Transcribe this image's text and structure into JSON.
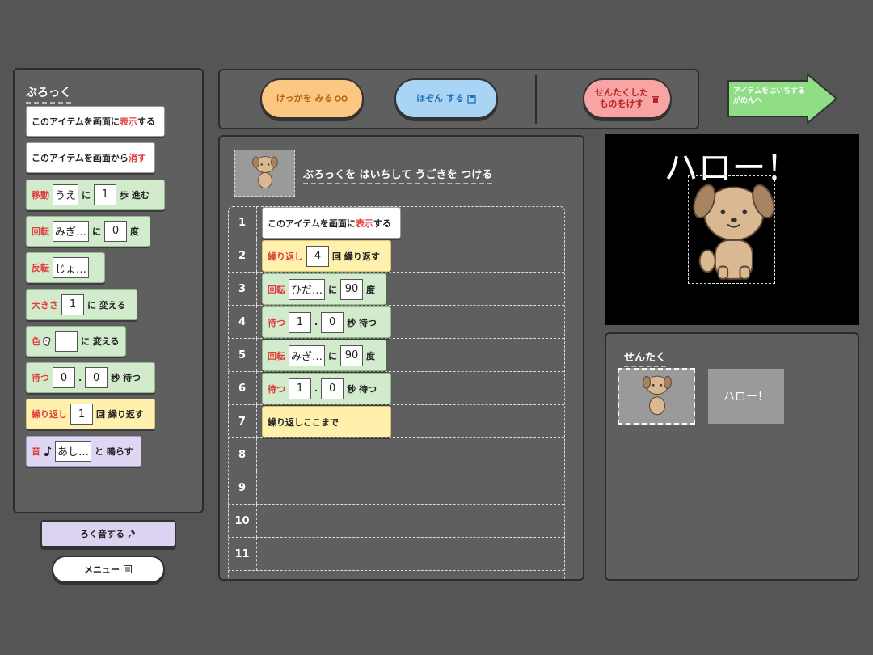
{
  "palette": {
    "heading": "ぶろっく",
    "blocks": [
      {
        "parts": [
          {
            "t": "このアイテムを画面に"
          },
          {
            "t": "表示",
            "red": true
          },
          {
            "t": "する"
          }
        ]
      },
      {
        "parts": [
          {
            "t": "このアイテムを画面から"
          },
          {
            "t": "消す",
            "red": true
          }
        ]
      },
      {
        "parts": [
          {
            "t": "移動",
            "red": true
          },
          {
            "box": "うえ"
          },
          {
            "t": "に"
          },
          {
            "box": "1"
          },
          {
            "t": "歩 進む"
          }
        ]
      },
      {
        "parts": [
          {
            "t": "回転",
            "red": true
          },
          {
            "box": "みぎ…"
          },
          {
            "t": "に"
          },
          {
            "box": "0"
          },
          {
            "t": "度"
          }
        ]
      },
      {
        "parts": [
          {
            "t": "反転",
            "red": true
          },
          {
            "box": "じょ…"
          }
        ]
      },
      {
        "parts": [
          {
            "t": "大きさ",
            "red": true
          },
          {
            "box": "1"
          },
          {
            "t": "に 変える"
          }
        ]
      },
      {
        "parts": [
          {
            "t": "色",
            "red": true
          },
          {
            "icon": "palette-icon"
          },
          {
            "box": " "
          },
          {
            "t": "に 変える"
          }
        ]
      },
      {
        "parts": [
          {
            "t": "待つ",
            "red": true
          },
          {
            "box": "0"
          },
          {
            "t": "."
          },
          {
            "box": "0"
          },
          {
            "t": "秒 待つ"
          }
        ]
      },
      {
        "parts": [
          {
            "t": "繰り返し",
            "red": true
          },
          {
            "box": "1"
          },
          {
            "t": "回 繰り返す"
          }
        ]
      },
      {
        "parts": [
          {
            "t": "音",
            "red": true
          },
          {
            "icon": "music-note-icon"
          },
          {
            "box": "あし…"
          },
          {
            "t": "と 鳴らす"
          }
        ]
      }
    ]
  },
  "buttons": {
    "record": "ろく音する",
    "menu": "メニュー"
  },
  "toolbar": {
    "result": "けっかを みる",
    "save": "ほぞん する",
    "delete_line1": "せんたくした",
    "delete_line2": "ものをけす"
  },
  "nav": {
    "line1": "アイテムをはいちする",
    "line2": "がめんへ"
  },
  "editor": {
    "heading": "ぶろっくを はいちして うごきを つける",
    "row_numbers": [
      "1",
      "2",
      "3",
      "4",
      "5",
      "6",
      "7",
      "8",
      "9",
      "10",
      "11"
    ],
    "rows": [
      {
        "parts": [
          {
            "t": "このアイテムを画面に"
          },
          {
            "t": "表示",
            "red": true
          },
          {
            "t": "する"
          }
        ]
      },
      {
        "parts": [
          {
            "t": "繰り返し",
            "red": true
          },
          {
            "box": "4"
          },
          {
            "t": "回 繰り返す"
          }
        ]
      },
      {
        "parts": [
          {
            "t": "回転",
            "red": true
          },
          {
            "box": "ひだ…"
          },
          {
            "t": "に"
          },
          {
            "box": "90"
          },
          {
            "t": "度"
          }
        ]
      },
      {
        "parts": [
          {
            "t": "待つ",
            "red": true
          },
          {
            "box": "1"
          },
          {
            "t": "."
          },
          {
            "box": "0"
          },
          {
            "t": "秒 待つ"
          }
        ]
      },
      {
        "parts": [
          {
            "t": "回転",
            "red": true
          },
          {
            "box": "みぎ…"
          },
          {
            "t": "に"
          },
          {
            "box": "90"
          },
          {
            "t": "度"
          }
        ]
      },
      {
        "parts": [
          {
            "t": "待つ",
            "red": true
          },
          {
            "box": "1"
          },
          {
            "t": "."
          },
          {
            "box": "0"
          },
          {
            "t": "秒 待つ"
          }
        ]
      },
      {
        "parts": [
          {
            "t": "繰り返しここまで"
          }
        ]
      }
    ]
  },
  "stage": {
    "text": "ハロー！"
  },
  "selection": {
    "heading": "せんたく",
    "text_item": "ハロー！"
  },
  "colors": {
    "background": "#555555",
    "panel": "#5f5f5f",
    "accent_red": "#e03d3d",
    "result_button": "#fcc783",
    "save_button": "#a9d4f3",
    "delete_button": "#f8a4a4",
    "nav_arrow": "#8fdd85",
    "stage": "#000000"
  }
}
